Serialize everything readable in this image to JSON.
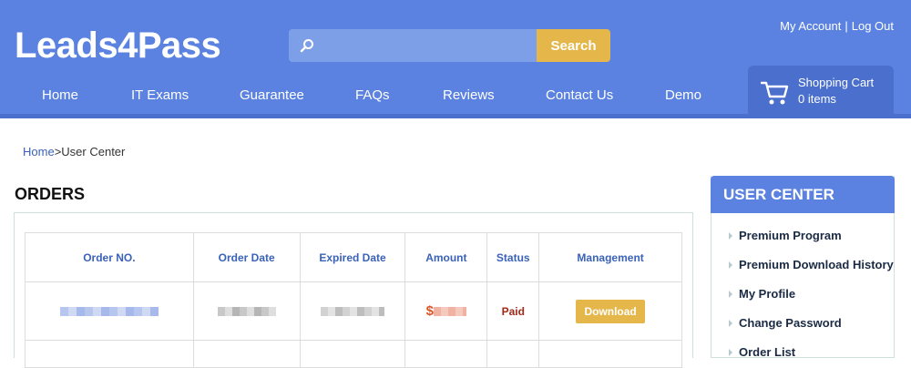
{
  "header": {
    "logo": "Leads4Pass",
    "search": {
      "placeholder": "",
      "button_label": "Search"
    },
    "account": {
      "my_account": "My Account",
      "separator": "|",
      "log_out": "Log Out"
    },
    "nav": [
      {
        "label": "Home"
      },
      {
        "label": "IT Exams"
      },
      {
        "label": "Guarantee"
      },
      {
        "label": "FAQs"
      },
      {
        "label": "Reviews"
      },
      {
        "label": "Contact Us"
      },
      {
        "label": "Demo"
      }
    ],
    "cart": {
      "title": "Shopping Cart",
      "count": "0 items"
    }
  },
  "breadcrumb": {
    "home": "Home",
    "separator": ">",
    "current": "User Center"
  },
  "orders": {
    "title": "ORDERS",
    "columns": [
      "Order NO.",
      "Order Date",
      "Expired Date",
      "Amount",
      "Status",
      "Management"
    ],
    "rows": [
      {
        "amount_prefix": "$",
        "status": "Paid",
        "action": "Download"
      }
    ]
  },
  "user_center": {
    "title": "USER CENTER",
    "items": [
      {
        "label": "Premium Program"
      },
      {
        "label": "Premium Download History"
      },
      {
        "label": "My Profile"
      },
      {
        "label": "Change Password"
      },
      {
        "label": "Order List"
      }
    ]
  },
  "colors": {
    "brand_blue": "#5b82e0",
    "accent_gold": "#e5b64a",
    "link_blue": "#3a62b8",
    "status_paid": "#a32a18"
  }
}
